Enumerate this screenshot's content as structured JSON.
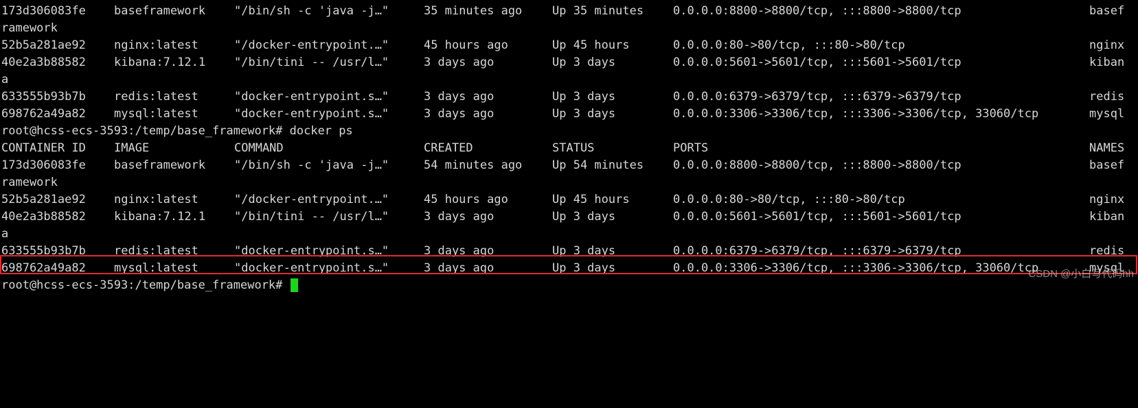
{
  "terminal": {
    "block1": {
      "rows": [
        {
          "id": "173d306083fe",
          "image": "baseframework",
          "command": "\"/bin/sh -c 'java -j…\"",
          "created": "35 minutes ago",
          "status": "Up 35 minutes",
          "ports": "0.0.0.0:8800->8800/tcp, :::8800->8800/tcp",
          "names": "basef",
          "wrap": "ramework"
        },
        {
          "id": "52b5a281ae92",
          "image": "nginx:latest",
          "command": "\"/docker-entrypoint.…\"",
          "created": "45 hours ago",
          "status": "Up 45 hours",
          "ports": "0.0.0.0:80->80/tcp, :::80->80/tcp",
          "names": "nginx"
        },
        {
          "id": "40e2a3b88582",
          "image": "kibana:7.12.1",
          "command": "\"/bin/tini -- /usr/l…\"",
          "created": "3 days ago",
          "status": "Up 3 days",
          "ports": "0.0.0.0:5601->5601/tcp, :::5601->5601/tcp",
          "names": "kiban",
          "wrap": "a"
        },
        {
          "id": "633555b93b7b",
          "image": "redis:latest",
          "command": "\"docker-entrypoint.s…\"",
          "created": "3 days ago",
          "status": "Up 3 days",
          "ports": "0.0.0.0:6379->6379/tcp, :::6379->6379/tcp",
          "names": "redis"
        },
        {
          "id": "698762a49a82",
          "image": "mysql:latest",
          "command": "\"docker-entrypoint.s…\"",
          "created": "3 days ago",
          "status": "Up 3 days",
          "ports": "0.0.0.0:3306->3306/tcp, :::3306->3306/tcp, 33060/tcp",
          "names": "mysql"
        }
      ]
    },
    "prompt1": "root@hcss-ecs-3593:/temp/base_framework# docker ps",
    "headers": {
      "id": "CONTAINER ID",
      "image": "IMAGE",
      "command": "COMMAND",
      "created": "CREATED",
      "status": "STATUS",
      "ports": "PORTS",
      "names": "NAMES"
    },
    "block2": {
      "rows": [
        {
          "id": "173d306083fe",
          "image": "baseframework",
          "command": "\"/bin/sh -c 'java -j…\"",
          "created": "54 minutes ago",
          "status": "Up 54 minutes",
          "ports": "0.0.0.0:8800->8800/tcp, :::8800->8800/tcp",
          "names": "basef",
          "wrap": "ramework"
        },
        {
          "id": "52b5a281ae92",
          "image": "nginx:latest",
          "command": "\"/docker-entrypoint.…\"",
          "created": "45 hours ago",
          "status": "Up 45 hours",
          "ports": "0.0.0.0:80->80/tcp, :::80->80/tcp",
          "names": "nginx"
        },
        {
          "id": "40e2a3b88582",
          "image": "kibana:7.12.1",
          "command": "\"/bin/tini -- /usr/l…\"",
          "created": "3 days ago",
          "status": "Up 3 days",
          "ports": "0.0.0.0:5601->5601/tcp, :::5601->5601/tcp",
          "names": "kiban",
          "wrap": "a"
        },
        {
          "id": "633555b93b7b",
          "image": "redis:latest",
          "command": "\"docker-entrypoint.s…\"",
          "created": "3 days ago",
          "status": "Up 3 days",
          "ports": "0.0.0.0:6379->6379/tcp, :::6379->6379/tcp",
          "names": "redis"
        },
        {
          "id": "698762a49a82",
          "image": "mysql:latest",
          "command": "\"docker-entrypoint.s…\"",
          "created": "3 days ago",
          "status": "Up 3 days",
          "ports": "0.0.0.0:3306->3306/tcp, :::3306->3306/tcp, 33060/tcp",
          "names": "mysql"
        }
      ]
    },
    "prompt2": "root@hcss-ecs-3593:/temp/base_framework# "
  },
  "watermark": "CSDN @小白写代码hh",
  "colors": {
    "background": "#000000",
    "text": "#d7d7d7",
    "cursor": "#16d816",
    "highlight": "#e02b33"
  }
}
